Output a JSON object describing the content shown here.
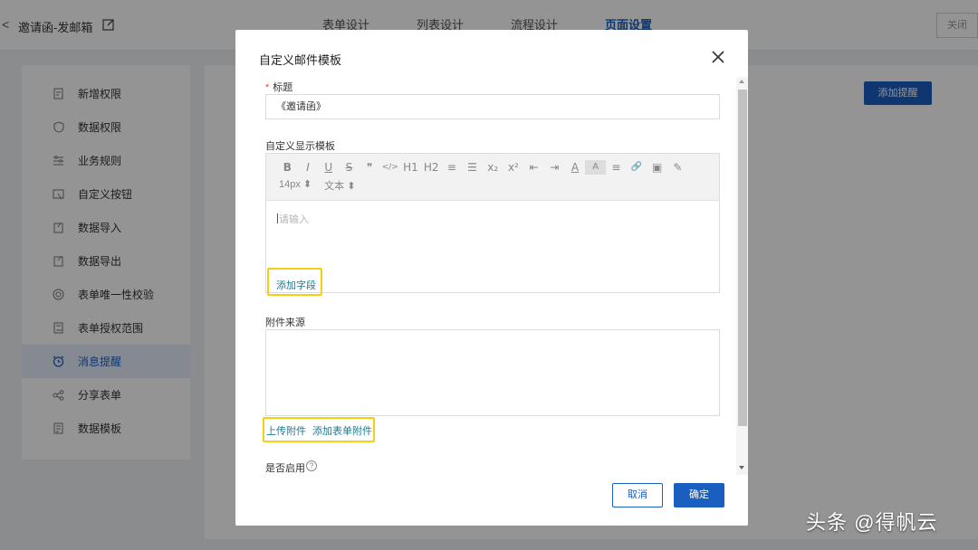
{
  "header": {
    "back_icon": "chevron-left-icon",
    "title": "邀请函-发邮箱",
    "tabs": [
      "表单设计",
      "列表设计",
      "流程设计",
      "页面设置"
    ],
    "active_tab": "页面设置",
    "close_label": "关闭"
  },
  "sidebar": {
    "items": [
      {
        "label": "新增权限",
        "icon": "add-permission-icon"
      },
      {
        "label": "数据权限",
        "icon": "shield-icon"
      },
      {
        "label": "业务规则",
        "icon": "sliders-icon"
      },
      {
        "label": "自定义按钮",
        "icon": "cursor-button-icon"
      },
      {
        "label": "数据导入",
        "icon": "import-icon"
      },
      {
        "label": "数据导出",
        "icon": "export-icon"
      },
      {
        "label": "表单唯一性校验",
        "icon": "unique-check-icon"
      },
      {
        "label": "表单授权范围",
        "icon": "authorize-icon"
      },
      {
        "label": "消息提醒",
        "icon": "alarm-clock-icon"
      },
      {
        "label": "分享表单",
        "icon": "share-icon"
      },
      {
        "label": "数据模板",
        "icon": "template-icon"
      }
    ],
    "active": "消息提醒"
  },
  "main": {
    "add_reminder_label": "添加提醒"
  },
  "modal": {
    "title": "自定义邮件模板",
    "title_field": {
      "required_mark": "*",
      "label": "标题",
      "value": "《邀请函》"
    },
    "template_label": "自定义显示模板",
    "toolbar_row1": [
      "B",
      "I",
      "U",
      "S",
      "❞",
      "</>",
      "H1",
      "H2",
      "≡",
      "☰",
      "x₂",
      "x²",
      "⇤",
      "⇥",
      "A",
      "A",
      "≡",
      "🔗",
      "▣",
      "✎"
    ],
    "font_size": "14px ⬍",
    "font_family": "文本 ⬍",
    "editor_placeholder": "请输入",
    "add_field_link": "添加字段",
    "attachment_label": "附件来源",
    "upload_link": "上传附件",
    "add_form_attachment_link": "添加表单附件",
    "enable_label": "是否启用",
    "cancel_label": "取消",
    "ok_label": "确定"
  },
  "watermark": "头条 @得帆云",
  "colors": {
    "primary": "#1a5fbf",
    "highlight": "#f5cf12",
    "link": "#1a7a8e",
    "required": "#e0483b"
  }
}
